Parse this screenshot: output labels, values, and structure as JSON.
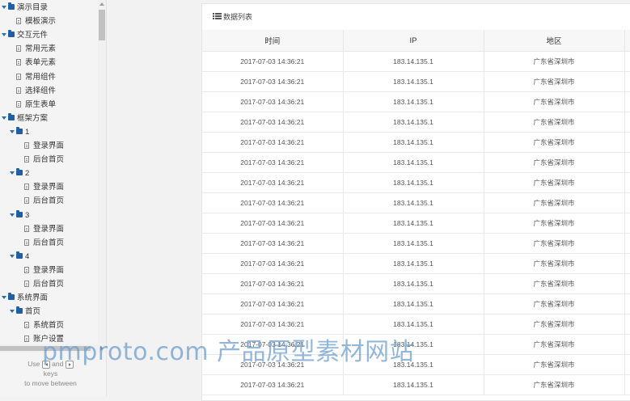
{
  "sidebar": {
    "items": [
      {
        "label": "演示目录",
        "kind": "folder",
        "level": 0,
        "expanded": true
      },
      {
        "label": "模板演示",
        "kind": "page",
        "level": 1
      },
      {
        "label": "交互元件",
        "kind": "folder",
        "level": 0,
        "expanded": true
      },
      {
        "label": "常用元素",
        "kind": "page",
        "level": 1
      },
      {
        "label": "表单元素",
        "kind": "page",
        "level": 1
      },
      {
        "label": "常用组件",
        "kind": "page",
        "level": 1
      },
      {
        "label": "选择组件",
        "kind": "page",
        "level": 1
      },
      {
        "label": "原生表单",
        "kind": "page",
        "level": 1
      },
      {
        "label": "框架方案",
        "kind": "folder",
        "level": 0,
        "expanded": true
      },
      {
        "label": "1",
        "kind": "folder",
        "level": 1,
        "expanded": true
      },
      {
        "label": "登录界面",
        "kind": "page",
        "level": 2
      },
      {
        "label": "后台首页",
        "kind": "page",
        "level": 2
      },
      {
        "label": "2",
        "kind": "folder",
        "level": 1,
        "expanded": true
      },
      {
        "label": "登录界面",
        "kind": "page",
        "level": 2
      },
      {
        "label": "后台首页",
        "kind": "page",
        "level": 2
      },
      {
        "label": "3",
        "kind": "folder",
        "level": 1,
        "expanded": true
      },
      {
        "label": "登录界面",
        "kind": "page",
        "level": 2
      },
      {
        "label": "后台首页",
        "kind": "page",
        "level": 2
      },
      {
        "label": "4",
        "kind": "folder",
        "level": 1,
        "expanded": true
      },
      {
        "label": "登录界面",
        "kind": "page",
        "level": 2
      },
      {
        "label": "后台首页",
        "kind": "page",
        "level": 2
      },
      {
        "label": "系统界面",
        "kind": "folder",
        "level": 0,
        "expanded": true
      },
      {
        "label": "首页",
        "kind": "folder",
        "level": 1,
        "expanded": true
      },
      {
        "label": "系统首页",
        "kind": "page",
        "level": 2
      },
      {
        "label": "账户设置",
        "kind": "page",
        "level": 2
      }
    ],
    "hint": {
      "use": "Use",
      "and": "and",
      "keys": "keys",
      "to_move": "to move between"
    }
  },
  "panel": {
    "title": "数据列表",
    "columns": [
      "时间",
      "IP",
      "地区",
      ""
    ],
    "rows": [
      [
        "2017-07-03 14:36:21",
        "183.14.135.1",
        "广东省深圳市",
        ""
      ],
      [
        "2017-07-03 14:36:21",
        "183.14.135.1",
        "广东省深圳市",
        ""
      ],
      [
        "2017-07-03 14:36:21",
        "183.14.135.1",
        "广东省深圳市",
        ""
      ],
      [
        "2017-07-03 14:36:21",
        "183.14.135.1",
        "广东省深圳市",
        ""
      ],
      [
        "2017-07-03 14:36:21",
        "183.14.135.1",
        "广东省深圳市",
        ""
      ],
      [
        "2017-07-03 14:36:21",
        "183.14.135.1",
        "广东省深圳市",
        ""
      ],
      [
        "2017-07-03 14:36:21",
        "183.14.135.1",
        "广东省深圳市",
        ""
      ],
      [
        "2017-07-03 14:36:21",
        "183.14.135.1",
        "广东省深圳市",
        ""
      ],
      [
        "2017-07-03 14:36:21",
        "183.14.135.1",
        "广东省深圳市",
        ""
      ],
      [
        "2017-07-03 14:36:21",
        "183.14.135.1",
        "广东省深圳市",
        ""
      ],
      [
        "2017-07-03 14:36:21",
        "183.14.135.1",
        "广东省深圳市",
        ""
      ],
      [
        "2017-07-03 14:36:21",
        "183.14.135.1",
        "广东省深圳市",
        ""
      ],
      [
        "2017-07-03 14:36:21",
        "183.14.135.1",
        "广东省深圳市",
        ""
      ],
      [
        "2017-07-03 14:36:21",
        "183.14.135.1",
        "广东省深圳市",
        ""
      ],
      [
        "2017-07-03 14:36:21",
        "183.14.135.1",
        "广东省深圳市",
        ""
      ],
      [
        "2017-07-03 14:36:21",
        "183.14.135.1",
        "广东省深圳市",
        ""
      ],
      [
        "2017-07-03 14:36:21",
        "183.14.135.1",
        "广东省深圳市",
        ""
      ]
    ]
  },
  "watermark": "pmproto.com 产品原型素材网站",
  "colors": {
    "folder": "#1f5fa6",
    "watermark": "#6e9fcf"
  }
}
